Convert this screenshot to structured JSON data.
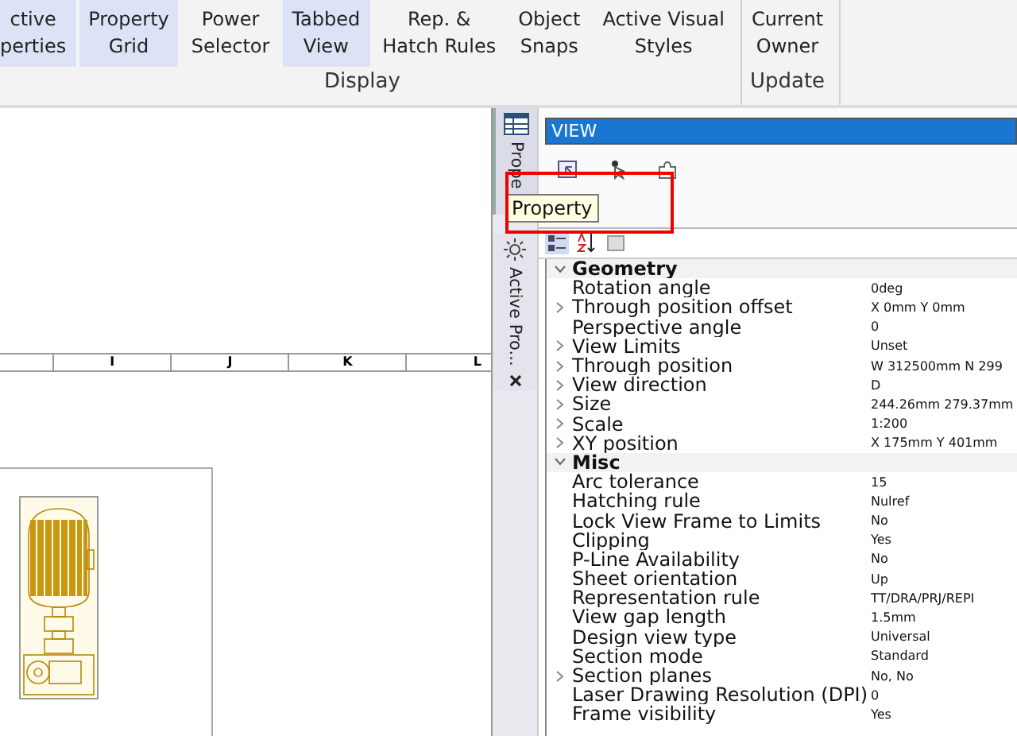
{
  "ribbon": {
    "groups": [
      {
        "label": "Display",
        "buttons": [
          {
            "lines": [
              "ctive",
              "perties"
            ],
            "selected": true
          },
          {
            "lines": [
              "Property",
              "Grid"
            ],
            "selected": true
          },
          {
            "lines": [
              "Power",
              "Selector"
            ],
            "selected": false
          },
          {
            "lines": [
              "Tabbed",
              "View"
            ],
            "selected": true
          },
          {
            "lines": [
              "Rep. &",
              "Hatch Rules"
            ],
            "selected": false
          },
          {
            "lines": [
              "Object",
              "Snaps"
            ],
            "selected": false
          },
          {
            "lines": [
              "Active Visual",
              "Styles"
            ],
            "selected": false
          }
        ]
      },
      {
        "label": "Update",
        "buttons": [
          {
            "lines": [
              "Current",
              "Owner"
            ],
            "selected": false
          }
        ]
      }
    ]
  },
  "ruler": {
    "labels": [
      "I",
      "J",
      "K",
      "L"
    ]
  },
  "dock_tabs": [
    {
      "label": "Prope",
      "selected": true,
      "kind": "grid"
    },
    {
      "label": "Active Pro...",
      "selected": false,
      "kind": "sun"
    }
  ],
  "panel": {
    "title": "VIEW",
    "tooltip": "Property",
    "toolbar": [
      {
        "kind": "categorized",
        "selected": true
      },
      {
        "kind": "alphabetical",
        "selected": false
      },
      {
        "kind": "pages",
        "selected": false
      }
    ],
    "categories": [
      {
        "name": "Geometry",
        "expanded": true,
        "rows": [
          {
            "name": "Rotation angle",
            "value": "0deg",
            "expandable": false
          },
          {
            "name": "Through position offset",
            "value": "X 0mm Y 0mm",
            "expandable": true
          },
          {
            "name": "Perspective angle",
            "value": "0",
            "expandable": false
          },
          {
            "name": "View Limits",
            "value": "Unset",
            "expandable": true
          },
          {
            "name": "Through position",
            "value": "W 312500mm N 299",
            "expandable": true
          },
          {
            "name": "View direction",
            "value": "D",
            "expandable": true
          },
          {
            "name": "Size",
            "value": "244.26mm 279.37mm",
            "expandable": true
          },
          {
            "name": "Scale",
            "value": "1:200",
            "expandable": true
          },
          {
            "name": "XY position",
            "value": "X 175mm Y 401mm",
            "expandable": true
          }
        ]
      },
      {
        "name": "Misc",
        "expanded": true,
        "rows": [
          {
            "name": "Arc tolerance",
            "value": "15",
            "expandable": false
          },
          {
            "name": "Hatching rule",
            "value": "Nulref",
            "expandable": false
          },
          {
            "name": "Lock View Frame to Limits",
            "value": "No",
            "expandable": false
          },
          {
            "name": "Clipping",
            "value": "Yes",
            "expandable": false
          },
          {
            "name": "P-Line Availability",
            "value": "No",
            "expandable": false
          },
          {
            "name": "Sheet orientation",
            "value": "Up",
            "expandable": false
          },
          {
            "name": "Representation rule",
            "value": "TT/DRA/PRJ/REPI",
            "expandable": false
          },
          {
            "name": "View gap length",
            "value": "1.5mm",
            "expandable": false
          },
          {
            "name": "Design view type",
            "value": "Universal",
            "expandable": false
          },
          {
            "name": "Section mode",
            "value": "Standard",
            "expandable": false
          },
          {
            "name": "Section planes",
            "value": "No, No",
            "expandable": true
          },
          {
            "name": "Laser Drawing Resolution (DPI)",
            "value": "0",
            "expandable": false
          },
          {
            "name": "Frame visibility",
            "value": "Yes",
            "expandable": false
          }
        ]
      }
    ]
  }
}
